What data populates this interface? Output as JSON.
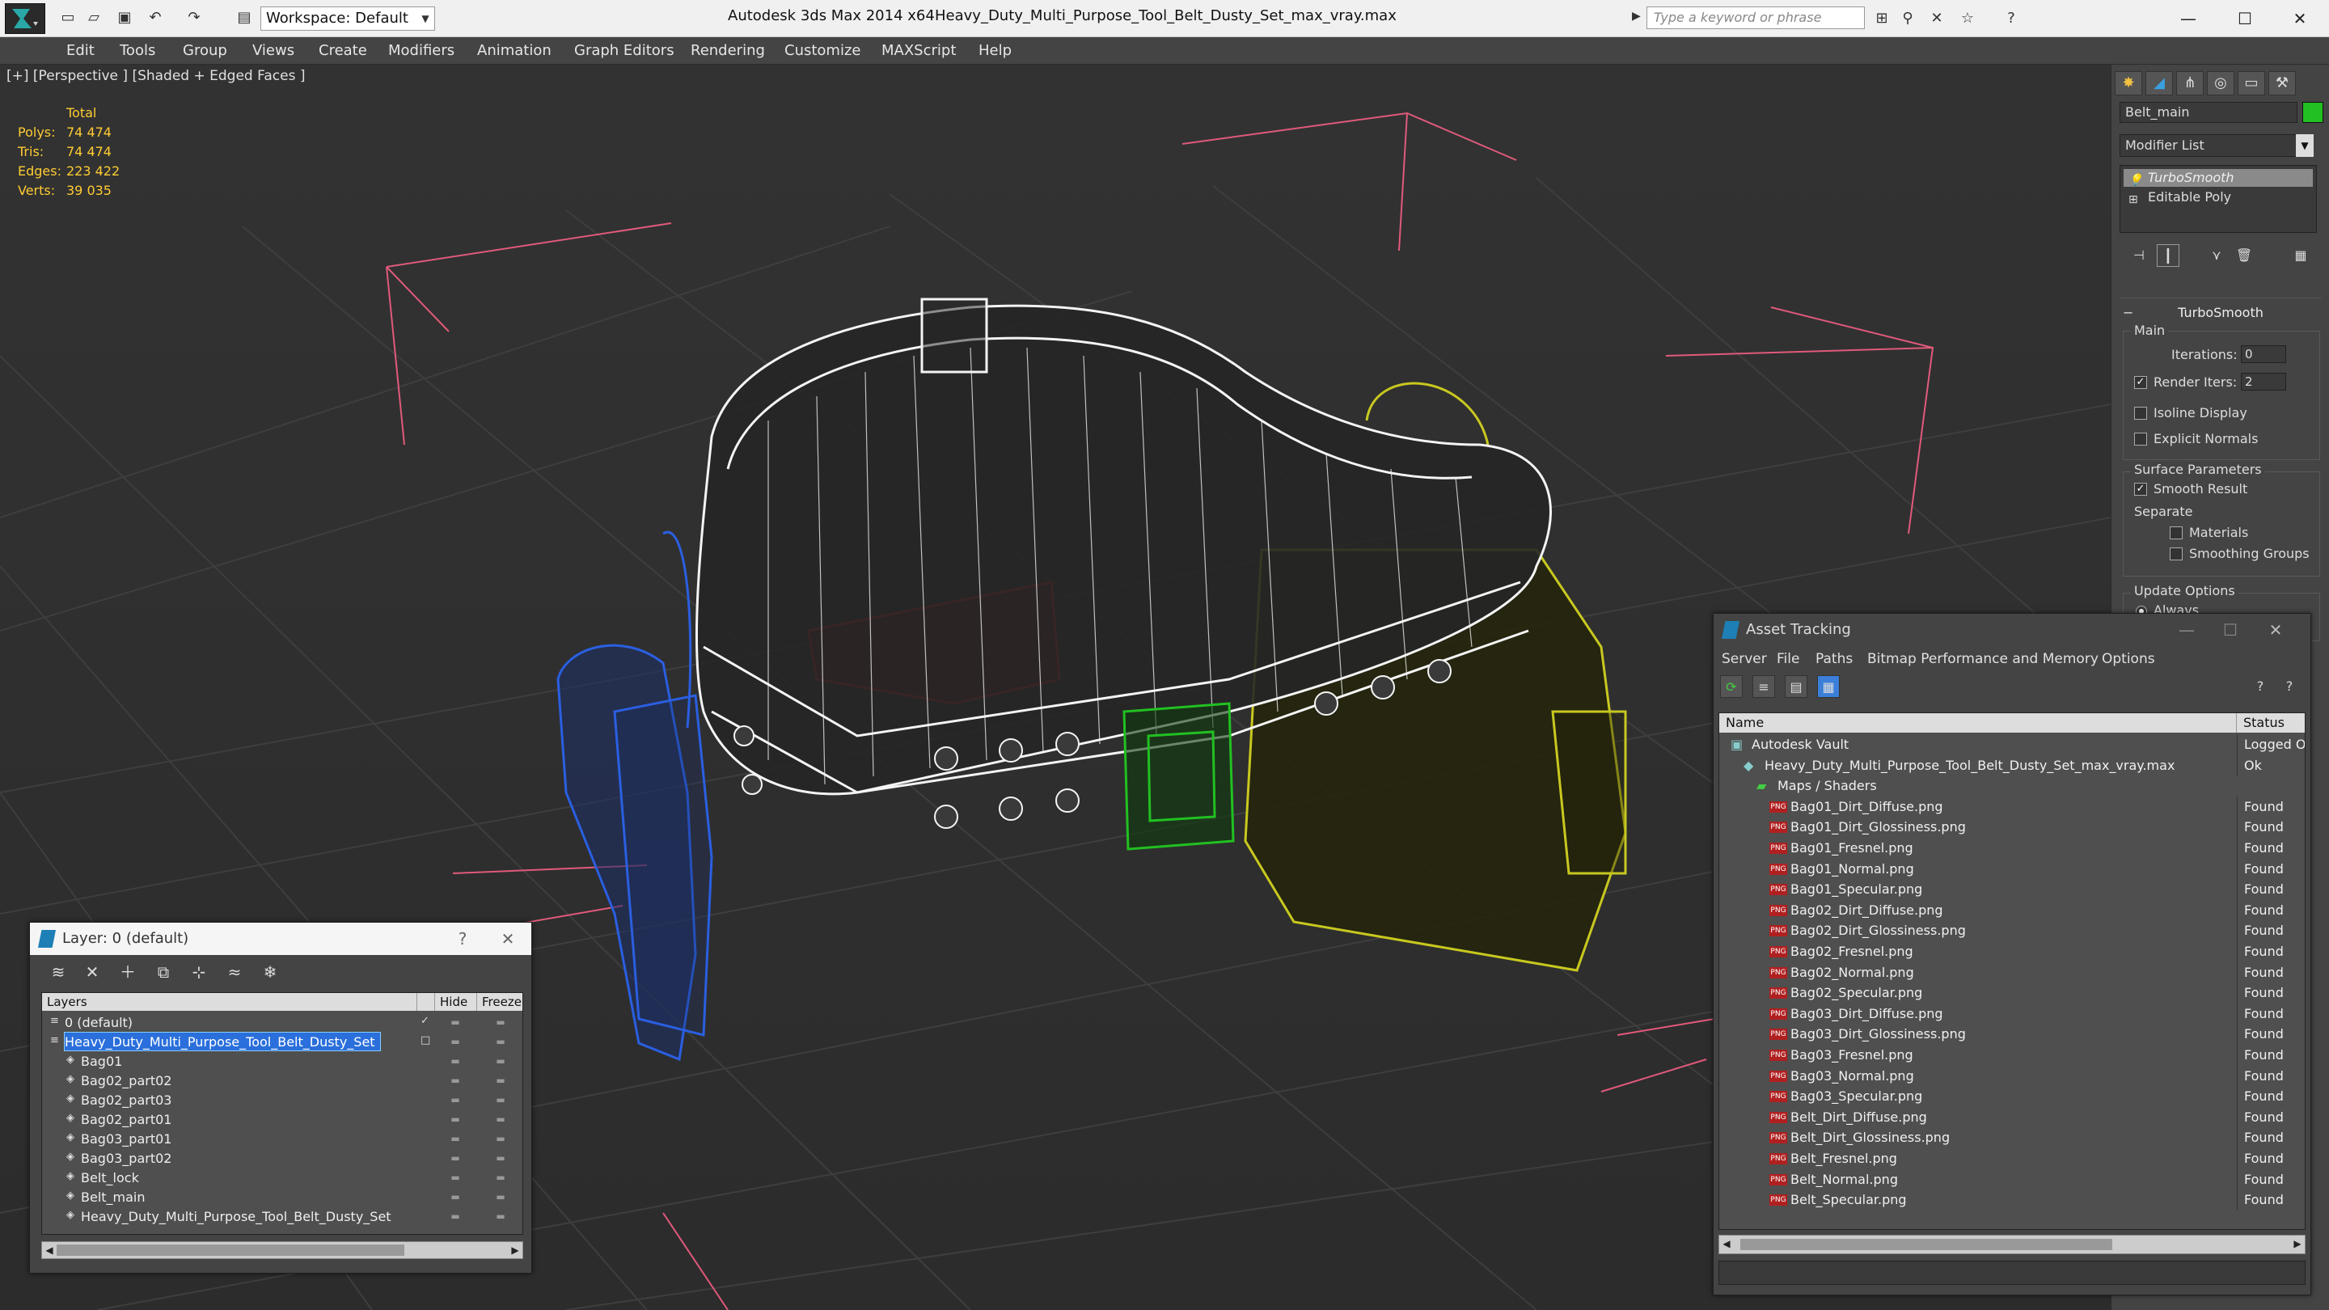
{
  "titlebar": {
    "workspace": "Workspace: Default",
    "app_title": "Autodesk 3ds Max  2014 x64",
    "doc_title": "Heavy_Duty_Multi_Purpose_Tool_Belt_Dusty_Set_max_vray.max",
    "search_placeholder": "Type a keyword or phrase"
  },
  "menu": [
    "Edit",
    "Tools",
    "Group",
    "Views",
    "Create",
    "Modifiers",
    "Animation",
    "Graph Editors",
    "Rendering",
    "Customize",
    "MAXScript",
    "Help"
  ],
  "viewport": {
    "label": "[+] [Perspective ] [Shaded + Edged Faces ]",
    "stats_header": "Total",
    "stats": [
      {
        "key": "Polys:",
        "value": "74 474"
      },
      {
        "key": "Tris:",
        "value": "74 474"
      },
      {
        "key": "Edges:",
        "value": "223 422"
      },
      {
        "key": "Verts:",
        "value": "39 035"
      }
    ]
  },
  "command_panel": {
    "object_name": "Belt_main",
    "object_color": "#22c022",
    "modifier_list": "Modifier List",
    "stack": [
      "TurboSmooth",
      "Editable Poly"
    ],
    "rollout_title": "TurboSmooth",
    "main_label": "Main",
    "iterations_label": "Iterations:",
    "iterations_value": "0",
    "render_iters_label": "Render Iters:",
    "render_iters_value": "2",
    "isoline_label": "Isoline Display",
    "explicit_label": "Explicit Normals",
    "surface_label": "Surface Parameters",
    "smooth_label": "Smooth Result",
    "separate_label": "Separate",
    "materials_label": "Materials",
    "smoothing_label": "Smoothing Groups",
    "update_label": "Update Options",
    "always_label": "Always"
  },
  "layer_window": {
    "title": "Layer: 0 (default)",
    "help": "?",
    "columns": [
      "Layers",
      "Hide",
      "Freeze"
    ],
    "rows": [
      {
        "name": "0 (default)",
        "level": 0,
        "checked": true,
        "selected": false
      },
      {
        "name": "Heavy_Duty_Multi_Purpose_Tool_Belt_Dusty_Set",
        "level": 0,
        "checked": false,
        "selected": true
      },
      {
        "name": "Bag01",
        "level": 1,
        "checked": false,
        "selected": false
      },
      {
        "name": "Bag02_part02",
        "level": 1,
        "checked": false,
        "selected": false
      },
      {
        "name": "Bag02_part03",
        "level": 1,
        "checked": false,
        "selected": false
      },
      {
        "name": "Bag02_part01",
        "level": 1,
        "checked": false,
        "selected": false
      },
      {
        "name": "Bag03_part01",
        "level": 1,
        "checked": false,
        "selected": false
      },
      {
        "name": "Bag03_part02",
        "level": 1,
        "checked": false,
        "selected": false
      },
      {
        "name": "Belt_lock",
        "level": 1,
        "checked": false,
        "selected": false
      },
      {
        "name": "Belt_main",
        "level": 1,
        "checked": false,
        "selected": false
      },
      {
        "name": "Heavy_Duty_Multi_Purpose_Tool_Belt_Dusty_Set",
        "level": 1,
        "checked": false,
        "selected": false
      }
    ]
  },
  "asset_window": {
    "title": "Asset Tracking",
    "menu": [
      "Server",
      "File",
      "Paths",
      "Bitmap Performance and Memory",
      "Options"
    ],
    "columns": [
      "Name",
      "Status"
    ],
    "rows": [
      {
        "name": "Autodesk Vault",
        "status": "Logged Out",
        "level": 0,
        "type": "vault"
      },
      {
        "name": "Heavy_Duty_Multi_Purpose_Tool_Belt_Dusty_Set_max_vray.max",
        "status": "Ok",
        "level": 1,
        "type": "max"
      },
      {
        "name": "Maps / Shaders",
        "status": "",
        "level": 2,
        "type": "folder"
      },
      {
        "name": "Bag01_Dirt_Diffuse.png",
        "status": "Found",
        "level": 3,
        "type": "png"
      },
      {
        "name": "Bag01_Dirt_Glossiness.png",
        "status": "Found",
        "level": 3,
        "type": "png"
      },
      {
        "name": "Bag01_Fresnel.png",
        "status": "Found",
        "level": 3,
        "type": "png"
      },
      {
        "name": "Bag01_Normal.png",
        "status": "Found",
        "level": 3,
        "type": "png"
      },
      {
        "name": "Bag01_Specular.png",
        "status": "Found",
        "level": 3,
        "type": "png"
      },
      {
        "name": "Bag02_Dirt_Diffuse.png",
        "status": "Found",
        "level": 3,
        "type": "png"
      },
      {
        "name": "Bag02_Dirt_Glossiness.png",
        "status": "Found",
        "level": 3,
        "type": "png"
      },
      {
        "name": "Bag02_Fresnel.png",
        "status": "Found",
        "level": 3,
        "type": "png"
      },
      {
        "name": "Bag02_Normal.png",
        "status": "Found",
        "level": 3,
        "type": "png"
      },
      {
        "name": "Bag02_Specular.png",
        "status": "Found",
        "level": 3,
        "type": "png"
      },
      {
        "name": "Bag03_Dirt_Diffuse.png",
        "status": "Found",
        "level": 3,
        "type": "png"
      },
      {
        "name": "Bag03_Dirt_Glossiness.png",
        "status": "Found",
        "level": 3,
        "type": "png"
      },
      {
        "name": "Bag03_Fresnel.png",
        "status": "Found",
        "level": 3,
        "type": "png"
      },
      {
        "name": "Bag03_Normal.png",
        "status": "Found",
        "level": 3,
        "type": "png"
      },
      {
        "name": "Bag03_Specular.png",
        "status": "Found",
        "level": 3,
        "type": "png"
      },
      {
        "name": "Belt_Dirt_Diffuse.png",
        "status": "Found",
        "level": 3,
        "type": "png"
      },
      {
        "name": "Belt_Dirt_Glossiness.png",
        "status": "Found",
        "level": 3,
        "type": "png"
      },
      {
        "name": "Belt_Fresnel.png",
        "status": "Found",
        "level": 3,
        "type": "png"
      },
      {
        "name": "Belt_Normal.png",
        "status": "Found",
        "level": 3,
        "type": "png"
      },
      {
        "name": "Belt_Specular.png",
        "status": "Found",
        "level": 3,
        "type": "png"
      }
    ]
  }
}
